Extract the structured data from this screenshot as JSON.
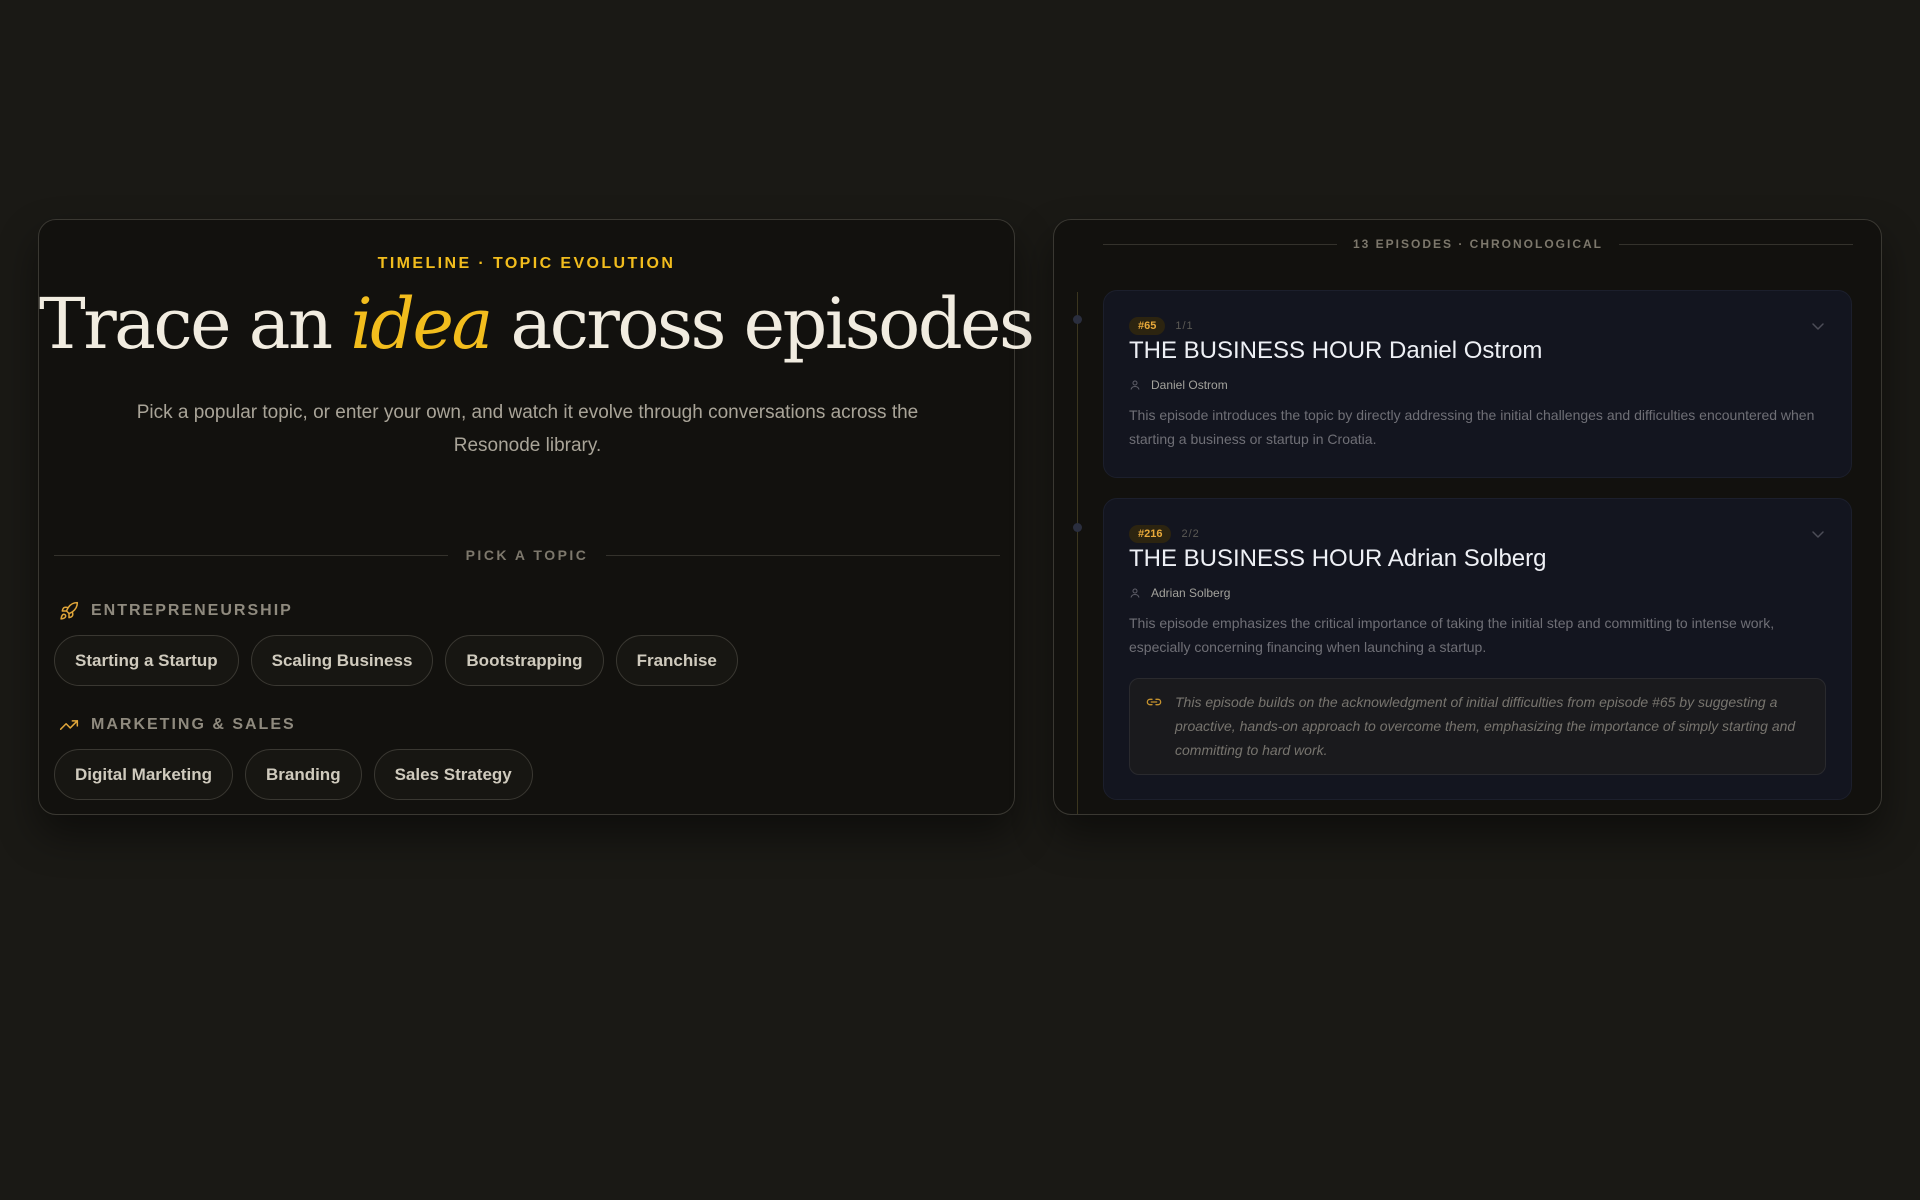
{
  "hero": {
    "eyebrow": "TIMELINE · TOPIC EVOLUTION",
    "title_pre": "Trace an",
    "title_em": "idea",
    "title_post": "across episodes",
    "subtitle": "Pick a popular topic, or enter your own, and watch it evolve through conversations across the Resonode library."
  },
  "picker": {
    "label": "PICK A TOPIC",
    "categories": [
      {
        "name": "ENTREPRENEURSHIP",
        "icon": "rocket-icon",
        "topics": [
          "Starting a Startup",
          "Scaling Business",
          "Bootstrapping",
          "Franchise"
        ]
      },
      {
        "name": "MARKETING & SALES",
        "icon": "trending-up-icon",
        "topics": [
          "Digital Marketing",
          "Branding",
          "Sales Strategy"
        ]
      }
    ]
  },
  "timeline": {
    "header": "13 EPISODES · CHRONOLOGICAL",
    "episodes": [
      {
        "badge": "#65",
        "count": "1/1",
        "title": "THE BUSINESS HOUR Daniel Ostrom",
        "person": "Daniel Ostrom",
        "description": "This episode introduces the topic by directly addressing the initial challenges and difficulties encountered when starting a business or startup in Croatia."
      },
      {
        "badge": "#216",
        "count": "2/2",
        "title": "THE BUSINESS HOUR Adrian Solberg",
        "person": "Adrian Solberg",
        "description": "This episode emphasizes the critical importance of taking the initial step and committing to intense work, especially concerning financing when launching a startup.",
        "connection": "This episode builds on the acknowledgment of initial difficulties from episode #65 by suggesting a proactive, hands-on approach to overcome them, emphasizing the importance of simply starting and committing to hard work."
      }
    ]
  },
  "colors": {
    "accent": "#f2bd1d",
    "background": "#1a1915",
    "panel": "#12110e",
    "card": "#13151f"
  }
}
